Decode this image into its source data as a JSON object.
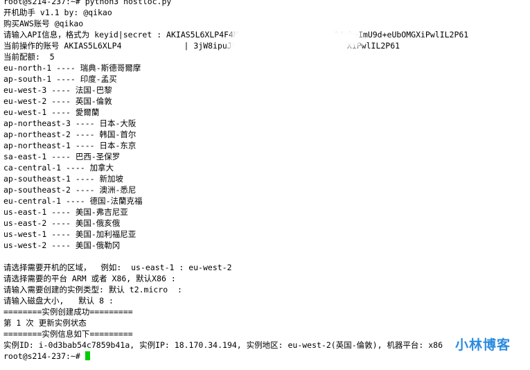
{
  "terminal": {
    "prompt_partial": "root@s214-237:~#",
    "command_partial": "python3 hostloc.py",
    "lines": [
      "root@s214-237:~# python3 hostloc.py",
      "开机助手 v1.1 by: @qikao",
      "购买AWS账号 @qikao",
      "请输入API信息，格式为 keyid|secret : AKIAS5L6XLP4F4M                    24uk+ImU9d+eUbOMGXiPwlIL2P61",
      "当前操作的账号 AKIAS5L6XLP4             | 3jW8ipuJh7                      XiPwlIL2P61",
      "当前配额:  5",
      "eu-north-1 ---- 瑞典-斯德哥爾摩",
      "ap-south-1 ---- 印度-孟买",
      "eu-west-3 ---- 法国-巴黎",
      "eu-west-2 ---- 英国-倫敦",
      "eu-west-1 ---- 愛爾蘭",
      "ap-northeast-3 ---- 日本-大阪",
      "ap-northeast-2 ---- 韩国-首尔",
      "ap-northeast-1 ---- 日本-东京",
      "sa-east-1 ---- 巴西-圣保罗",
      "ca-central-1 ---- 加拿大",
      "ap-southeast-1 ---- 新加坡",
      "ap-southeast-2 ---- 澳洲-悉尼",
      "eu-central-1 ---- 德国-法蘭克福",
      "us-east-1 ---- 美国-弗吉尼亚",
      "us-east-2 ---- 美国-俄亥俄",
      "us-west-1 ---- 美国-加利福尼亚",
      "us-west-2 ---- 美国-俄勒冈",
      "",
      "请选择需要开机的区域，  例如:  us-east-1 : eu-west-2",
      "请选择需要的平台 ARM 或者 X86, 默认X86 :",
      "请输入需要创建的实例类型: 默认 t2.micro  :",
      "请输入磁盘大小,   默认 8 :",
      "========实例创建成功=========",
      "第 1 次 更新实例状态",
      "========实例信息如下=========",
      "实例ID: i-0d3bab54c7859b41a, 实例IP: 18.170.34.194, 实例地区: eu-west-2(英国-倫敦), 机器平台: x86"
    ],
    "final_prompt": "root@s214-237:~#",
    "cursor_color": "#00cc00"
  },
  "watermark": {
    "text": "小林博客",
    "color": "#2a8be0"
  }
}
